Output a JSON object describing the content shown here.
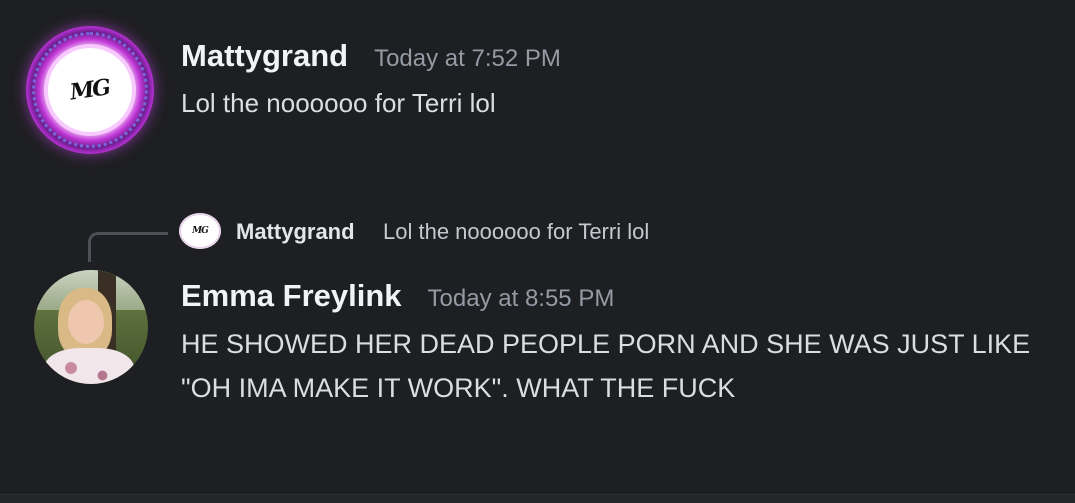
{
  "messages": [
    {
      "username": "Mattygrand",
      "timestamp": "Today at 7:52 PM",
      "text": "Lol the noooooo for Terri lol",
      "avatar_icon": "mg-monogram-avatar",
      "avatar_monogram": "MG"
    },
    {
      "username": "Emma Freylink",
      "timestamp": "Today at 8:55 PM",
      "text": "HE SHOWED HER DEAD PEOPLE PORN AND SHE WAS JUST LIKE \"OH IMA MAKE IT WORK\". WHAT THE FUCK",
      "avatar_icon": "user-photo-avatar"
    }
  ],
  "reply": {
    "username": "Mattygrand",
    "text": "Lol the noooooo for Terri lol",
    "avatar_monogram": "MG"
  },
  "colors": {
    "background": "#1e1f22",
    "username": "#f2f3f5",
    "timestamp": "#949ba4",
    "message_text": "#dbdee1"
  }
}
